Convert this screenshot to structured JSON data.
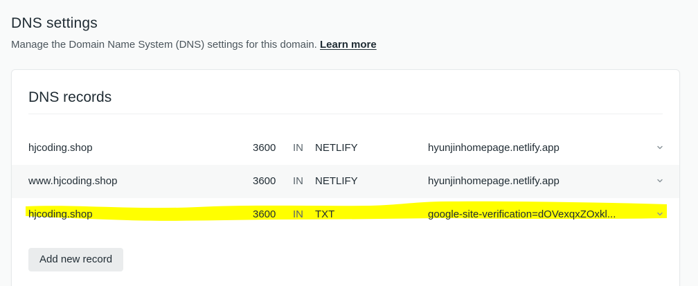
{
  "header": {
    "title": "DNS settings",
    "subtitle": "Manage the Domain Name System (DNS) settings for this domain.",
    "learn_more": "Learn more"
  },
  "card": {
    "title": "DNS records",
    "add_button": "Add new record"
  },
  "records": [
    {
      "host": "hjcoding.shop",
      "ttl": "3600",
      "class": "IN",
      "type": "NETLIFY",
      "value": "hyunjinhomepage.netlify.app",
      "icon": "chevron-down-icon"
    },
    {
      "host": "www.hjcoding.shop",
      "ttl": "3600",
      "class": "IN",
      "type": "NETLIFY",
      "value": "hyunjinhomepage.netlify.app",
      "icon": "chevron-down-icon"
    },
    {
      "host": "hjcoding.shop",
      "ttl": "3600",
      "class": "IN",
      "type": "TXT",
      "value": "google-site-verification=dOVexqxZOxkl...",
      "icon": "chevron-down-icon",
      "highlight_color": "#ffff00"
    }
  ]
}
